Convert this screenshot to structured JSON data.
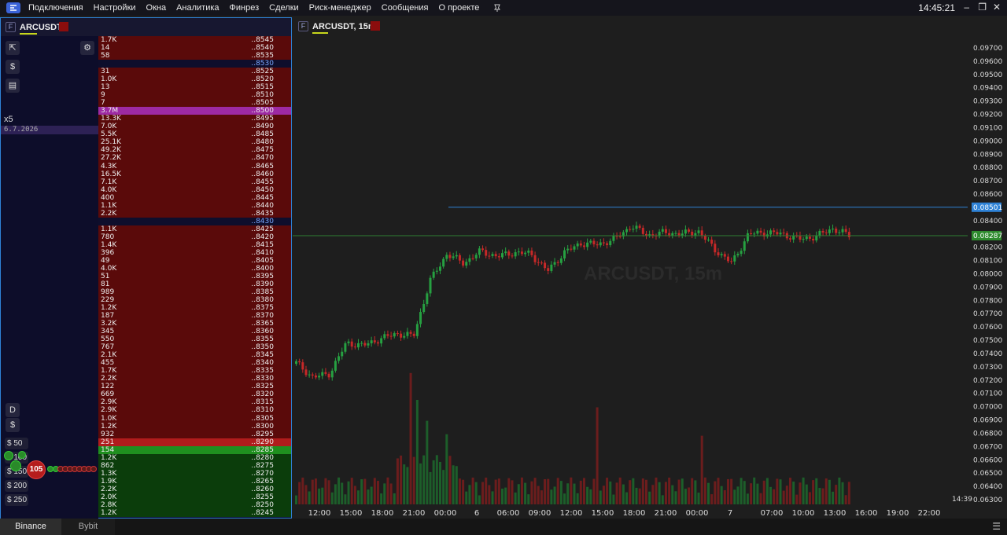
{
  "menu": {
    "items": [
      "Подключения",
      "Настройки",
      "Окна",
      "Аналитика",
      "Финрез",
      "Сделки",
      "Риск-менеджер",
      "Сообщения",
      "О проекте"
    ],
    "clock": "14:45:21"
  },
  "orderbook": {
    "badge": "F",
    "symbol": "ARCUSDT",
    "multiplier": "x5",
    "date": "6.7.2026",
    "mode_label": "D",
    "dollar_label": "$",
    "bubble_value": "105",
    "amounts": [
      "$ 50",
      "$ 100",
      "$ 150",
      "$ 200",
      "$ 250"
    ],
    "rows": [
      {
        "vol": "1.7K",
        "price": "..8545",
        "side": "ask"
      },
      {
        "vol": "14",
        "price": "..8540",
        "side": "ask"
      },
      {
        "vol": "58",
        "price": "..8535",
        "side": "ask"
      },
      {
        "vol": "",
        "price": "..8530",
        "side": "gap"
      },
      {
        "vol": "31",
        "price": "..8525",
        "side": "ask"
      },
      {
        "vol": "1.0K",
        "price": "..8520",
        "side": "ask"
      },
      {
        "vol": "13",
        "price": "..8515",
        "side": "ask"
      },
      {
        "vol": "9",
        "price": "..8510",
        "side": "ask"
      },
      {
        "vol": "7",
        "price": "..8505",
        "side": "ask"
      },
      {
        "vol": "3.7M",
        "price": "..8500",
        "side": "purple"
      },
      {
        "vol": "13.3K",
        "price": "..8495",
        "side": "ask"
      },
      {
        "vol": "7.0K",
        "price": "..8490",
        "side": "ask"
      },
      {
        "vol": "5.5K",
        "price": "..8485",
        "side": "ask"
      },
      {
        "vol": "25.1K",
        "price": "..8480",
        "side": "ask"
      },
      {
        "vol": "49.2K",
        "price": "..8475",
        "side": "ask"
      },
      {
        "vol": "27.2K",
        "price": "..8470",
        "side": "ask"
      },
      {
        "vol": "4.3K",
        "price": "..8465",
        "side": "ask"
      },
      {
        "vol": "16.5K",
        "price": "..8460",
        "side": "ask"
      },
      {
        "vol": "7.1K",
        "price": "..8455",
        "side": "ask"
      },
      {
        "vol": "4.0K",
        "price": "..8450",
        "side": "ask"
      },
      {
        "vol": "400",
        "price": "..8445",
        "side": "ask"
      },
      {
        "vol": "1.1K",
        "price": "..8440",
        "side": "ask"
      },
      {
        "vol": "2.2K",
        "price": "..8435",
        "side": "ask"
      },
      {
        "vol": "",
        "price": "..8430",
        "side": "gap"
      },
      {
        "vol": "1.1K",
        "price": "..8425",
        "side": "ask"
      },
      {
        "vol": "780",
        "price": "..8420",
        "side": "ask"
      },
      {
        "vol": "1.4K",
        "price": "..8415",
        "side": "ask"
      },
      {
        "vol": "396",
        "price": "..8410",
        "side": "ask"
      },
      {
        "vol": "49",
        "price": "..8405",
        "side": "ask"
      },
      {
        "vol": "4.0K",
        "price": "..8400",
        "side": "ask"
      },
      {
        "vol": "51",
        "price": "..8395",
        "side": "ask"
      },
      {
        "vol": "81",
        "price": "..8390",
        "side": "ask"
      },
      {
        "vol": "989",
        "price": "..8385",
        "side": "ask"
      },
      {
        "vol": "229",
        "price": "..8380",
        "side": "ask"
      },
      {
        "vol": "1.2K",
        "price": "..8375",
        "side": "ask"
      },
      {
        "vol": "187",
        "price": "..8370",
        "side": "ask"
      },
      {
        "vol": "3.2K",
        "price": "..8365",
        "side": "ask"
      },
      {
        "vol": "345",
        "price": "..8360",
        "side": "ask"
      },
      {
        "vol": "550",
        "price": "..8355",
        "side": "ask"
      },
      {
        "vol": "767",
        "price": "..8350",
        "side": "ask"
      },
      {
        "vol": "2.1K",
        "price": "..8345",
        "side": "ask"
      },
      {
        "vol": "455",
        "price": "..8340",
        "side": "ask"
      },
      {
        "vol": "1.7K",
        "price": "..8335",
        "side": "ask"
      },
      {
        "vol": "2.2K",
        "price": "..8330",
        "side": "ask"
      },
      {
        "vol": "122",
        "price": "..8325",
        "side": "ask"
      },
      {
        "vol": "669",
        "price": "..8320",
        "side": "ask"
      },
      {
        "vol": "2.9K",
        "price": "..8315",
        "side": "ask"
      },
      {
        "vol": "2.9K",
        "price": "..8310",
        "side": "ask"
      },
      {
        "vol": "1.0K",
        "price": "..8305",
        "side": "ask"
      },
      {
        "vol": "1.2K",
        "price": "..8300",
        "side": "ask"
      },
      {
        "vol": "932",
        "price": "..8295",
        "side": "ask"
      },
      {
        "vol": "251",
        "price": "..8290",
        "side": "best-ask"
      },
      {
        "vol": "154",
        "price": "..8285",
        "side": "best-bid"
      },
      {
        "vol": "1.2K",
        "price": "..8280",
        "side": "bid"
      },
      {
        "vol": "862",
        "price": "..8275",
        "side": "bid"
      },
      {
        "vol": "1.3K",
        "price": "..8270",
        "side": "bid"
      },
      {
        "vol": "1.9K",
        "price": "..8265",
        "side": "bid"
      },
      {
        "vol": "2.2K",
        "price": "..8260",
        "side": "bid"
      },
      {
        "vol": "2.0K",
        "price": "..8255",
        "side": "bid"
      },
      {
        "vol": "2.8K",
        "price": "..8250",
        "side": "bid"
      },
      {
        "vol": "1.2K",
        "price": "..8245",
        "side": "bid"
      }
    ]
  },
  "chart": {
    "badge": "F",
    "title": "ARCUSDT, 15m",
    "watermark": "ARCUSDT, 15m",
    "price_labels": [
      "0.09700",
      "0.09600",
      "0.09500",
      "0.09400",
      "0.09300",
      "0.09200",
      "0.09100",
      "0.09000",
      "0.08900",
      "0.08800",
      "0.08700",
      "0.08600",
      "0.08400",
      "0.08200",
      "0.08100",
      "0.08000",
      "0.07900",
      "0.07800",
      "0.07700",
      "0.07600",
      "0.07500",
      "0.07400",
      "0.07300",
      "0.07200",
      "0.07100",
      "0.07000",
      "0.06900",
      "0.06800",
      "0.06700",
      "0.06600",
      "0.06500",
      "0.06400",
      "0.06300"
    ],
    "blue_line_label": "0.08501",
    "current_price_label": "0.08287",
    "time_labels": [
      "12:00",
      "15:00",
      "18:00",
      "21:00",
      "00:00",
      "6",
      "06:00",
      "09:00",
      "12:00",
      "15:00",
      "18:00",
      "21:00",
      "00:00",
      "7",
      "07:00",
      "10:00",
      "13:00",
      "16:00",
      "19:00",
      "22:00"
    ],
    "cursor_time": "14:39",
    "colors": {
      "up": "#26a041",
      "down": "#c62828",
      "blue_line": "#2e82d6",
      "price_line": "#2e7d32"
    }
  },
  "chart_data": {
    "type": "candlestick",
    "title": "ARCUSDT, 15m",
    "ylim": [
      0.063,
      0.0975
    ],
    "close_path": [
      {
        "t": "10:30",
        "v": 0.0733
      },
      {
        "t": "12:00",
        "v": 0.0722
      },
      {
        "t": "13:30",
        "v": 0.0725
      },
      {
        "t": "15:00",
        "v": 0.0748
      },
      {
        "t": "16:30",
        "v": 0.0746
      },
      {
        "t": "18:00",
        "v": 0.0751
      },
      {
        "t": "19:30",
        "v": 0.0755
      },
      {
        "t": "20:30",
        "v": 0.0753
      },
      {
        "t": "21:00",
        "v": 0.0795
      },
      {
        "t": "22:00",
        "v": 0.0815
      },
      {
        "t": "23:30",
        "v": 0.0808
      },
      {
        "t": "01:00",
        "v": 0.0817
      },
      {
        "t": "03:00",
        "v": 0.0813
      },
      {
        "t": "05:00",
        "v": 0.0816
      },
      {
        "t": "06:00",
        "v": 0.0815
      },
      {
        "t": "07:30",
        "v": 0.0802
      },
      {
        "t": "08:30",
        "v": 0.0816
      },
      {
        "t": "10:30",
        "v": 0.0823
      },
      {
        "t": "12:00",
        "v": 0.0822
      },
      {
        "t": "14:00",
        "v": 0.0826
      },
      {
        "t": "15:30",
        "v": 0.0836
      },
      {
        "t": "17:00",
        "v": 0.0829
      },
      {
        "t": "19:00",
        "v": 0.0831
      },
      {
        "t": "21:00",
        "v": 0.083
      },
      {
        "t": "23:00",
        "v": 0.0832
      },
      {
        "t": "00:00",
        "v": 0.0818
      },
      {
        "t": "00:30",
        "v": 0.0808
      },
      {
        "t": "01:30",
        "v": 0.083
      },
      {
        "t": "04:00",
        "v": 0.0831
      },
      {
        "t": "07:00",
        "v": 0.083
      },
      {
        "t": "09:30",
        "v": 0.0826
      },
      {
        "t": "11:00",
        "v": 0.0828
      },
      {
        "t": "13:00",
        "v": 0.0834
      },
      {
        "t": "14:30",
        "v": 0.0829
      }
    ],
    "volume_peaks": [
      {
        "t": "21:00",
        "level": 0.88
      },
      {
        "t": "22:00",
        "level": 0.56
      },
      {
        "t": "00:00",
        "level": 0.47
      },
      {
        "t": "15:00",
        "level": 0.65
      },
      {
        "t": "00:00",
        "level": 0.46
      }
    ],
    "hlines": [
      {
        "value": 0.08501,
        "color": "blue"
      },
      {
        "value": 0.08287,
        "color": "green"
      }
    ]
  },
  "bottom_tabs": [
    "Binance",
    "Bybit"
  ]
}
